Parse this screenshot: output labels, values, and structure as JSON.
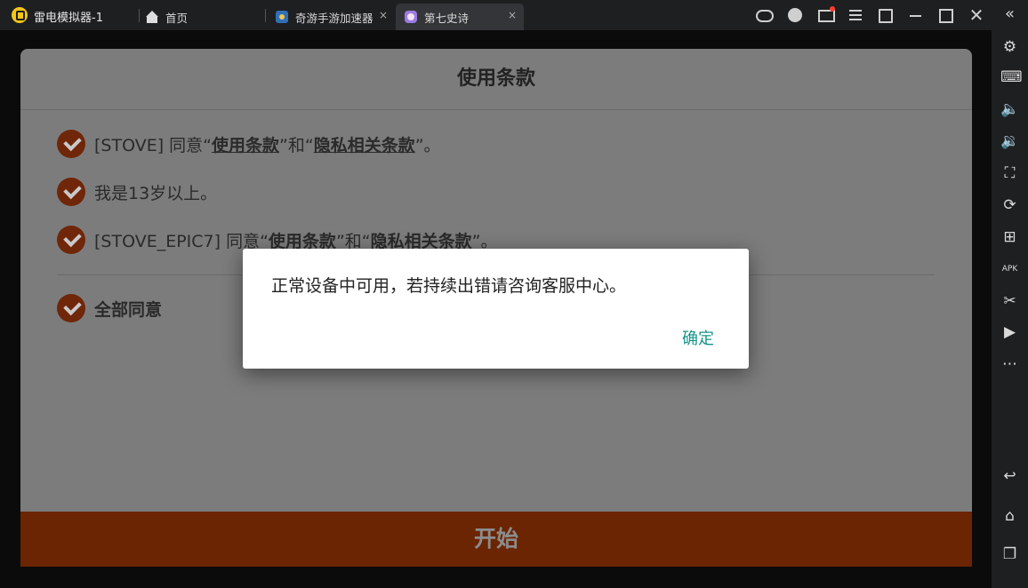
{
  "titlebar": {
    "app_title": "雷电模拟器-1",
    "tabs": [
      {
        "label": "首页",
        "icon": "home-icon"
      },
      {
        "label": "奇游手游加速器",
        "icon": "qiyou-app-icon"
      },
      {
        "label": "第七史诗",
        "icon": "epic7-app-icon"
      }
    ],
    "close_glyph": "×"
  },
  "sidebar_icons": [
    "settings-icon",
    "keyboard-icon",
    "volume-down-icon",
    "volume-up-icon",
    "screenshot-icon",
    "record-icon",
    "add-app-icon",
    "apk-install-icon",
    "scissors-icon",
    "video-icon",
    "more-icon",
    "back-icon",
    "home-icon",
    "recent-apps-icon"
  ],
  "terms": {
    "title": "使用条款",
    "row1": {
      "prefix": "[STOVE] 同意“",
      "terms": "使用条款",
      "and": "”和“",
      "privacy": "隐私相关条款",
      "suffix": "”。"
    },
    "row2": "我是13岁以上。",
    "row3": {
      "prefix": "[STOVE_EPIC7] 同意“",
      "terms": "使用条款",
      "and": "”和“",
      "privacy": "隐私相关条款",
      "suffix": "”。"
    },
    "agree_all": "全部同意",
    "start_button": "开始"
  },
  "dialog": {
    "message": "正常设备中可用，若持续出错请咨询客服中心。",
    "ok": "确定"
  },
  "colors": {
    "accent_orange": "#c8521c",
    "dialog_button": "#149488",
    "chrome": "#1e1f21"
  }
}
